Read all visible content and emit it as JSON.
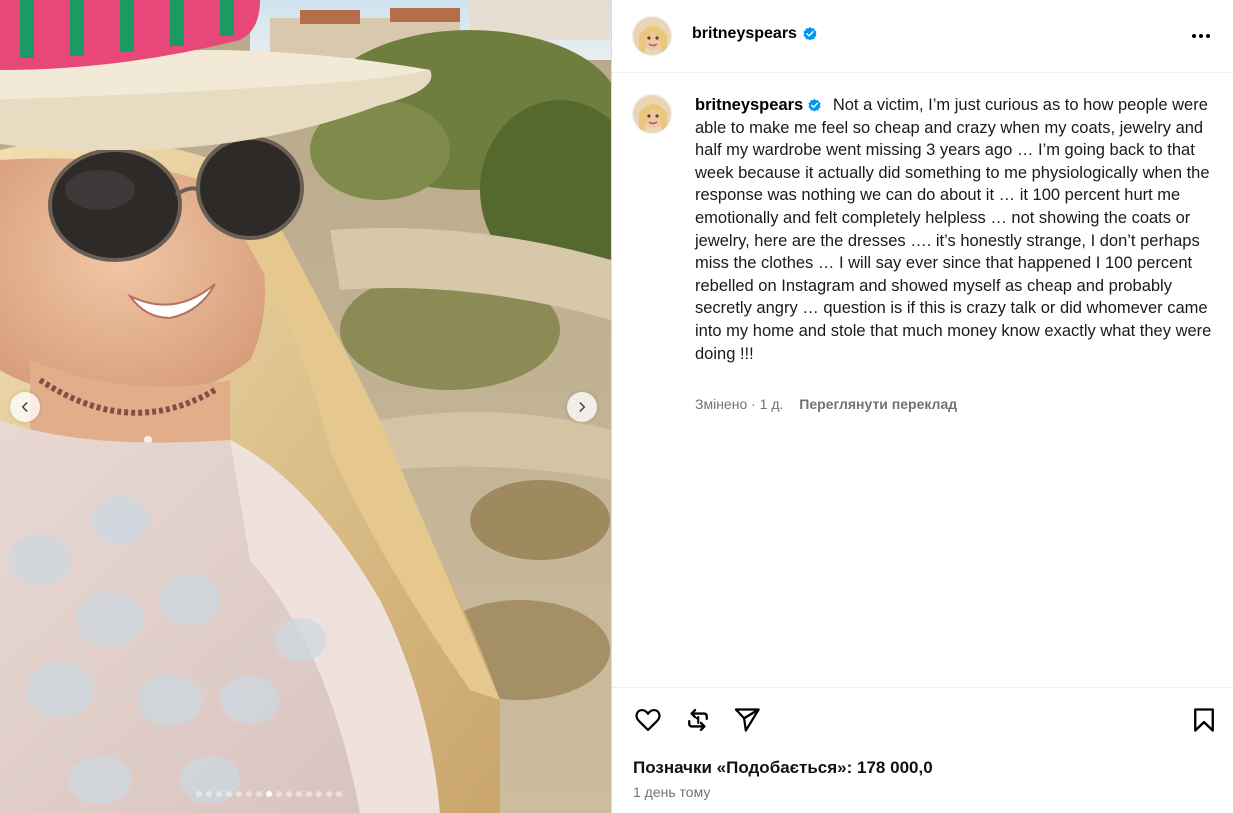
{
  "post": {
    "username": "britneyspears",
    "verified": true,
    "caption_text": "Not a victim, I’m just curious as to how people were able to make me feel so cheap and crazy when my coats, jewelry and half my wardrobe went missing 3 years ago … I’m going back to that week because it actually did something to me physiologically when the response was nothing we can do about it … it 100 percent hurt me emotionally and felt completely helpless … not showing the coats or jewelry, here are the dresses …. it’s honestly strange, I don’t perhaps miss the clothes … I will say ever since that happened I 100 percent rebelled on Instagram and showed myself as cheap and probably secretly angry … question is if this is crazy talk or did whomever came into my home and stole that much money know exactly what they were doing !!!",
    "edited_meta": "Змінено · 1 д.",
    "see_translation": "Переглянути переклад",
    "likes_text": "Позначки «Подобається»: 178 000,0",
    "time_ago": "1 день тому"
  },
  "media": {
    "carousel_total": 15,
    "carousel_active": 7
  },
  "icons": {
    "more": "more-horizontal-icon",
    "like": "heart-icon",
    "repost": "repost-icon",
    "share": "send-icon",
    "save": "bookmark-icon",
    "prev": "chevron-left-icon",
    "next": "chevron-right-icon",
    "verified": "verified-badge-icon"
  },
  "colors": {
    "verified": "#0095f6",
    "muted_text": "#737373",
    "divider": "#dbdbdb"
  }
}
